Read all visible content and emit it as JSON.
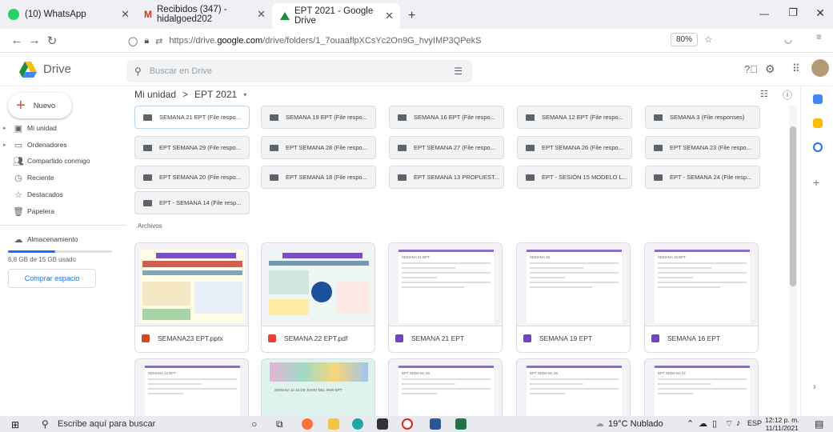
{
  "browser": {
    "tabs": [
      {
        "label": "(10) WhatsApp",
        "color": "#25d366"
      },
      {
        "label": "Recibidos (347) - hidalgoed202",
        "color": "#d93025"
      },
      {
        "label": "EPT 2021 - Google Drive",
        "color": "#1e8e3e"
      }
    ],
    "new_tab": "+",
    "url_prefix": "https://drive.",
    "url_domain": "google.com",
    "url_path": "/drive/folders/1_7ouaaflpXCsYc2On9G_hvyIMP3QPekS",
    "zoom": "80%"
  },
  "drive": {
    "brand": "Drive",
    "search_placeholder": "Buscar en Drive",
    "new_label": "Nuevo",
    "nav": [
      {
        "label": "Mi unidad",
        "icon": "my-drive-icon"
      },
      {
        "label": "Ordenadores",
        "icon": "computer-icon"
      },
      {
        "label": "Compartido conmigo",
        "icon": "shared-icon"
      },
      {
        "label": "Reciente",
        "icon": "clock-icon"
      },
      {
        "label": "Destacados",
        "icon": "star-icon"
      },
      {
        "label": "Papelera",
        "icon": "trash-icon"
      }
    ],
    "storage_label": "Almacenamiento",
    "storage_used": "6,8 GB de 15 GB usado",
    "storage_fraction": 0.45,
    "buy_storage": "Comprar espacio",
    "breadcrumb_root": "Mi unidad",
    "breadcrumb_sep": ">",
    "breadcrumb_current": "EPT 2021",
    "folders": [
      "SEMANA 21 EPT (File respo...",
      "SEMANA 19 EPT (File respo...",
      "SEMANA 16 EPT (File respo...",
      "SEMANA 12 EPT (File respo...",
      "SEMANA 3 (File responses)",
      "EPT SEMANA 29 (File respo...",
      "EPT SEMANA 28 (File respo...",
      "EPT SEMANA 27 (File respo...",
      "EPT SEMANA 26 (File respo...",
      "EPT SEMANA 23 (File respo...",
      "EPT SEMANA 20 (File respo...",
      "EPT SEMANA 18 (File respo...",
      "EPT SEMANA 13 PROPUEST...",
      "EPT - SESIÓN 15 MODELO L...",
      "EPT - SEMANA 24 (File resp...",
      "EPT - SEMANA 14 (File resp..."
    ],
    "files_heading": "Archivos",
    "files": [
      {
        "name": "SEMANA23 EPT.pptx",
        "type_color": "#d24726"
      },
      {
        "name": "SEMANA 22 EPT.pdf",
        "type_color": "#ea4335"
      },
      {
        "name": "SEMANA 21 EPT",
        "type_color": "#7248b9"
      },
      {
        "name": "SEMANA 19 EPT",
        "type_color": "#7248b9"
      },
      {
        "name": "SEMANA 16 EPT",
        "type_color": "#7248b9"
      }
    ],
    "thumb_titles": [
      "SEMANA 21 EPT",
      "SEMANA 19",
      "SEMANA 16 EPT"
    ],
    "row2_titles": [
      "SEMANA 12 EPT",
      "SEMANA 11-16 DE JUNIO DEL 2020 EPT",
      "EPT SEMANA 29",
      "EPT SEMANA 28",
      "EPT SEMANA 27"
    ]
  },
  "taskbar": {
    "search": "Escribe aquí para buscar",
    "weather": "19°C  Nublado",
    "lang": "ESP",
    "time": "12:12 p. m.",
    "date": "11/11/2021"
  }
}
